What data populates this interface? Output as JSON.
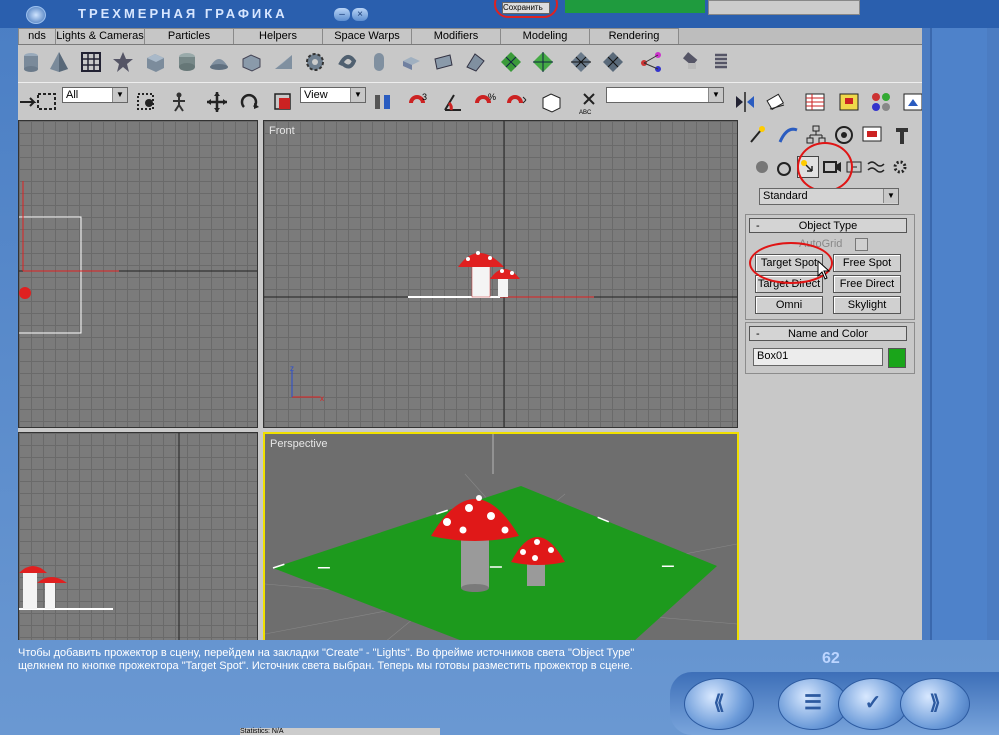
{
  "window": {
    "title": "ТРЕХМЕРНАЯ ГРАФИКА",
    "min_label": "–",
    "close_label": "×",
    "top_button": "Сохранить"
  },
  "tabs": [
    "nds",
    "Lights & Cameras",
    "Particles",
    "Helpers",
    "Space Warps",
    "Modifiers",
    "Modeling",
    "Rendering"
  ],
  "toolbar2": {
    "selection_filter": "All",
    "coord_system": "View",
    "named_selection": "",
    "abc_label": "ABC"
  },
  "viewports": {
    "front": "Front",
    "perspective": "Perspective",
    "axis_x": "x",
    "axis_z": "z"
  },
  "command_panel": {
    "category_dropdown": "Standard",
    "object_type_title": "Object Type",
    "autogrid_label": "AutoGrid",
    "buttons": [
      "Target Spot",
      "Free Spot",
      "Target Direct",
      "Free Direct",
      "Omni",
      "Skylight"
    ],
    "name_color_title": "Name and Color",
    "object_name": "Box01",
    "object_color": "#1aa51a",
    "rollout_toggle": "-"
  },
  "description": "Чтобы добавить прожектор в сцену, перейдем на закладки \"Create\" - \"Lights\". Во фрейме источников света \"Object Type\" щелкнем по кнопке прожектора \"Target Spot\". Источник света выбран. Теперь мы готовы разместить прожектор в сцене.",
  "page_number": "62",
  "nav": {
    "first": "⟪",
    "menu": "☰",
    "check": "✓",
    "next": "⟫"
  },
  "status_text": "Statistics: N/A"
}
